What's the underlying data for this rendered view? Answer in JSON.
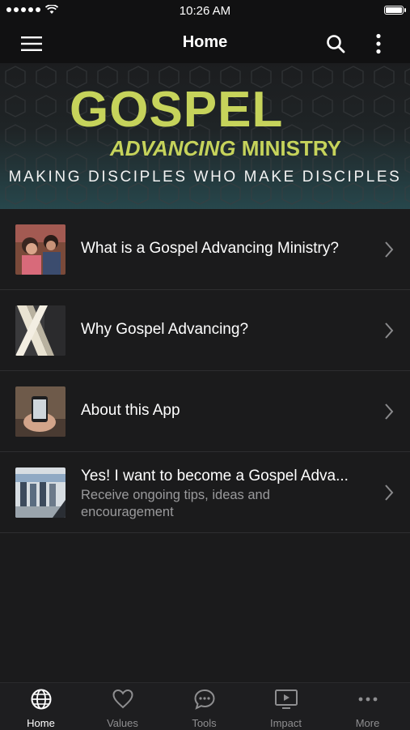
{
  "status_bar": {
    "time": "10:26 AM"
  },
  "nav": {
    "title": "Home",
    "menu_icon": "hamburger-menu-icon",
    "search_icon": "search-icon",
    "more_icon": "vertical-dots-icon"
  },
  "hero": {
    "title": "GOSPEL",
    "subtitle_italic": "ADVANCING",
    "subtitle_rest": "MINISTRY",
    "tagline": "MAKING DISCIPLES WHO MAKE DISCIPLES",
    "accent_color": "#c6d35b"
  },
  "list": [
    {
      "title": "What is a Gospel Advancing Ministry?",
      "subtitle": "",
      "thumb": "students-photo"
    },
    {
      "title": "Why Gospel Advancing?",
      "subtitle": "",
      "thumb": "x-graphic"
    },
    {
      "title": "About this App",
      "subtitle": "",
      "thumb": "phone-in-hand-photo"
    },
    {
      "title": "Yes! I want to become a Gospel Adva...",
      "subtitle": "Receive ongoing tips, ideas and encouragement",
      "thumb": "group-photo"
    }
  ],
  "tabs": [
    {
      "label": "Home",
      "icon": "globe-icon",
      "active": true
    },
    {
      "label": "Values",
      "icon": "heart-icon",
      "active": false
    },
    {
      "label": "Tools",
      "icon": "chat-bubble-icon",
      "active": false
    },
    {
      "label": "Impact",
      "icon": "play-screen-icon",
      "active": false
    },
    {
      "label": "More",
      "icon": "more-dots-icon",
      "active": false
    }
  ]
}
